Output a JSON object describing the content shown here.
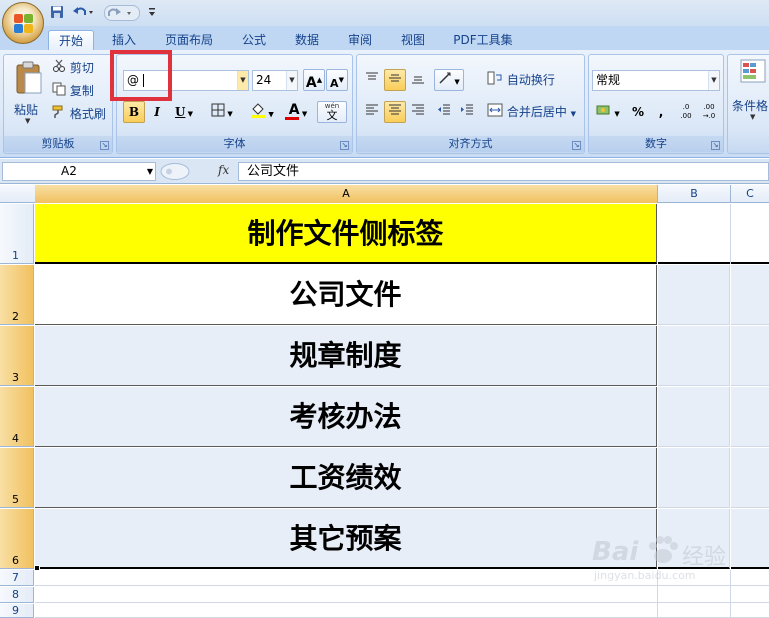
{
  "quick_access": {
    "icons": [
      "save-icon",
      "undo-icon",
      "redo-icon",
      "customize-icon"
    ]
  },
  "tabs": [
    "开始",
    "插入",
    "页面布局",
    "公式",
    "数据",
    "审阅",
    "视图",
    "PDF工具集"
  ],
  "active_tab": "开始",
  "clipboard": {
    "paste": "粘贴",
    "cut": "剪切",
    "copy": "复制",
    "format_painter": "格式刷",
    "label": "剪贴板"
  },
  "font": {
    "name": "@",
    "size": "24",
    "grow": "A",
    "shrink": "A",
    "bold": "B",
    "italic": "I",
    "underline": "U",
    "font_color": "A",
    "wen": "wén",
    "phonetic": "文",
    "label": "字体"
  },
  "alignment": {
    "wrap_text": "自动换行",
    "merge_center": "合并后居中",
    "label": "对齐方式"
  },
  "number": {
    "format": "常规",
    "percent": "%",
    "comma": ",",
    "inc_decimal": ".0",
    "inc_decimal_b": ".00",
    "dec_decimal": ".00",
    "dec_decimal_b": "→.0",
    "label": "数字"
  },
  "styles": {
    "conditional": "条件格"
  },
  "formula_bar": {
    "name_box": "A2",
    "fx": "fx",
    "content": "公司文件"
  },
  "columns": [
    "A",
    "B",
    "C"
  ],
  "rows": [
    {
      "num": "1",
      "text": "制作文件侧标签"
    },
    {
      "num": "2",
      "text": "公司文件"
    },
    {
      "num": "3",
      "text": "规章制度"
    },
    {
      "num": "4",
      "text": "考核办法"
    },
    {
      "num": "5",
      "text": "工资绩效"
    },
    {
      "num": "6",
      "text": "其它预案"
    },
    {
      "num": "7",
      "text": ""
    },
    {
      "num": "8",
      "text": ""
    },
    {
      "num": "9",
      "text": ""
    }
  ],
  "watermark": {
    "brand": "Bai",
    "brand2": "经验",
    "url": "jingyan.baidu.com"
  },
  "colors": {
    "header_fill": "#ffff00",
    "selection": "#e8eef7",
    "highlight_box": "#e0323c"
  }
}
